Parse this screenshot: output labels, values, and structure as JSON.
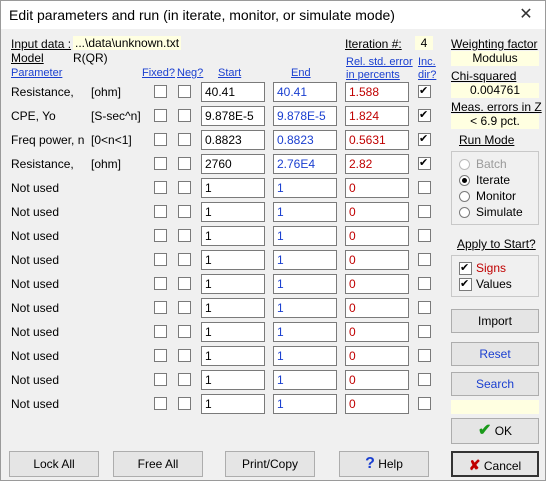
{
  "window": {
    "title": "Edit parameters and run (in iterate, monitor, or simulate mode)",
    "close_symbol": "✕"
  },
  "info": {
    "input_label": "Input data :",
    "input_value": "...\\data\\unknown.txt",
    "model_label": "Model",
    "model_value": "R(QR)",
    "iteration_label": "Iteration #:",
    "iteration_value": "4"
  },
  "headers": {
    "parameter": "Parameter",
    "fixed": "Fixed?",
    "neg": "Neg?",
    "start": "Start",
    "end": "End",
    "rel_err_1": "Rel. std. error",
    "rel_err_2": "in percents",
    "inc_1": "Inc.",
    "inc_2": "dir?"
  },
  "rows": [
    {
      "name": "Resistance,",
      "unit": "[ohm]",
      "fixed": false,
      "neg": false,
      "start": "40.41",
      "end": "40.41",
      "err": "1.588",
      "inc": true
    },
    {
      "name": "CPE,  Yo",
      "unit": "[S-sec^n]",
      "fixed": false,
      "neg": false,
      "start": "9.878E-5",
      "end": "9.878E-5",
      "err": "1.824",
      "inc": true
    },
    {
      "name": "Freq power, n",
      "unit": "[0<n<1]",
      "fixed": false,
      "neg": false,
      "start": "0.8823",
      "end": "0.8823",
      "err": "0.5631",
      "inc": true
    },
    {
      "name": "Resistance,",
      "unit": "[ohm]",
      "fixed": false,
      "neg": false,
      "start": "2760",
      "end": "2.76E4",
      "err": "2.82",
      "inc": true
    },
    {
      "name": "Not used",
      "unit": "",
      "fixed": false,
      "neg": false,
      "start": "1",
      "end": "1",
      "err": "0",
      "inc": false
    },
    {
      "name": "Not used",
      "unit": "",
      "fixed": false,
      "neg": false,
      "start": "1",
      "end": "1",
      "err": "0",
      "inc": false
    },
    {
      "name": "Not used",
      "unit": "",
      "fixed": false,
      "neg": false,
      "start": "1",
      "end": "1",
      "err": "0",
      "inc": false
    },
    {
      "name": "Not used",
      "unit": "",
      "fixed": false,
      "neg": false,
      "start": "1",
      "end": "1",
      "err": "0",
      "inc": false
    },
    {
      "name": "Not used",
      "unit": "",
      "fixed": false,
      "neg": false,
      "start": "1",
      "end": "1",
      "err": "0",
      "inc": false
    },
    {
      "name": "Not used",
      "unit": "",
      "fixed": false,
      "neg": false,
      "start": "1",
      "end": "1",
      "err": "0",
      "inc": false
    },
    {
      "name": "Not used",
      "unit": "",
      "fixed": false,
      "neg": false,
      "start": "1",
      "end": "1",
      "err": "0",
      "inc": false
    },
    {
      "name": "Not used",
      "unit": "",
      "fixed": false,
      "neg": false,
      "start": "1",
      "end": "1",
      "err": "0",
      "inc": false
    },
    {
      "name": "Not used",
      "unit": "",
      "fixed": false,
      "neg": false,
      "start": "1",
      "end": "1",
      "err": "0",
      "inc": false
    },
    {
      "name": "Not used",
      "unit": "",
      "fixed": false,
      "neg": false,
      "start": "1",
      "end": "1",
      "err": "0",
      "inc": false
    }
  ],
  "right": {
    "weighting_label": "Weighting factor",
    "weighting_value": "Modulus",
    "chi_label": "Chi-squared",
    "chi_value": "0.004761",
    "meas_label": "Meas. errors in Z",
    "meas_value": "< 6.9 pct.",
    "run_mode_label": "Run Mode",
    "modes": [
      "Batch",
      "Iterate",
      "Monitor",
      "Simulate"
    ],
    "selected_mode": "Iterate",
    "apply_label": "Apply to Start?",
    "signs_label": "Signs",
    "values_label": "Values",
    "import_label": "Import",
    "reset_label": "Reset",
    "search_label": "Search",
    "ok_label": "OK",
    "cancel_label": "Cancel"
  },
  "bottom": {
    "lock_all": "Lock All",
    "free_all": "Free All",
    "print_copy": "Print/Copy",
    "help": "Help"
  },
  "colors": {
    "accent_blue": "#1a3fd0",
    "error_red": "#c00000",
    "info_yellow": "#ffffe1",
    "ok_green": "#1a9a1a"
  }
}
